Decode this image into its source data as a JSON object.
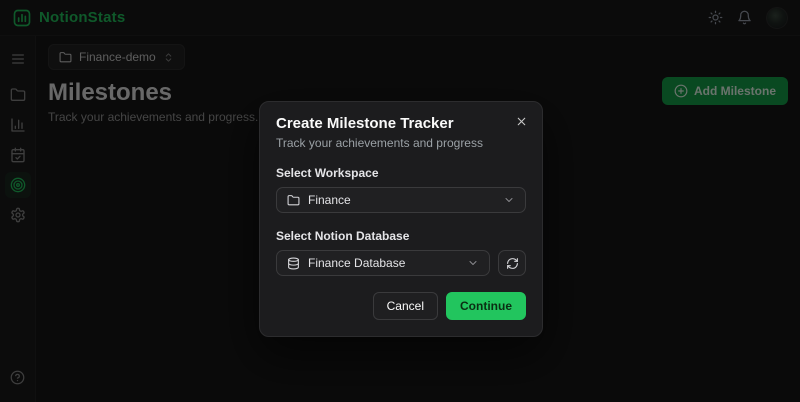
{
  "app": {
    "name": "NotionStats"
  },
  "header": {
    "theme_toggle_icon": "sun-icon",
    "notifications_icon": "bell-icon",
    "avatar_icon": "user-avatar"
  },
  "sidebar": {
    "items": [
      {
        "icon": "menu-icon",
        "active": false
      },
      {
        "icon": "folder-icon",
        "active": false
      },
      {
        "icon": "bar-chart-icon",
        "active": false
      },
      {
        "icon": "calendar-check-icon",
        "active": false
      },
      {
        "icon": "target-icon",
        "active": true
      },
      {
        "icon": "gear-icon",
        "active": false
      }
    ],
    "footer_icon": "help-circle-icon"
  },
  "page": {
    "workspace_selector": {
      "value": "Finance-demo",
      "icon": "folder-icon",
      "chevron": "chevrons-up-down-icon"
    },
    "title": "Milestones",
    "subtitle": "Track your achievements and progress.",
    "add_button": {
      "label": "Add Milestone",
      "icon": "plus-circle-icon"
    }
  },
  "modal": {
    "title": "Create Milestone Tracker",
    "subtitle": "Track your achievements and progress",
    "close_icon": "x-icon",
    "workspace_field": {
      "label": "Select Workspace",
      "value": "Finance",
      "icon": "folder-icon"
    },
    "database_field": {
      "label": "Select Notion Database",
      "value": "Finance Database",
      "icon": "database-icon",
      "refresh_icon": "refresh-icon"
    },
    "buttons": {
      "cancel": "Cancel",
      "continue": "Continue"
    }
  },
  "colors": {
    "accent_green": "#22c55e",
    "add_button_green": "#16a34a",
    "modal_bg": "#1c1c1e",
    "page_bg": "#171717"
  }
}
